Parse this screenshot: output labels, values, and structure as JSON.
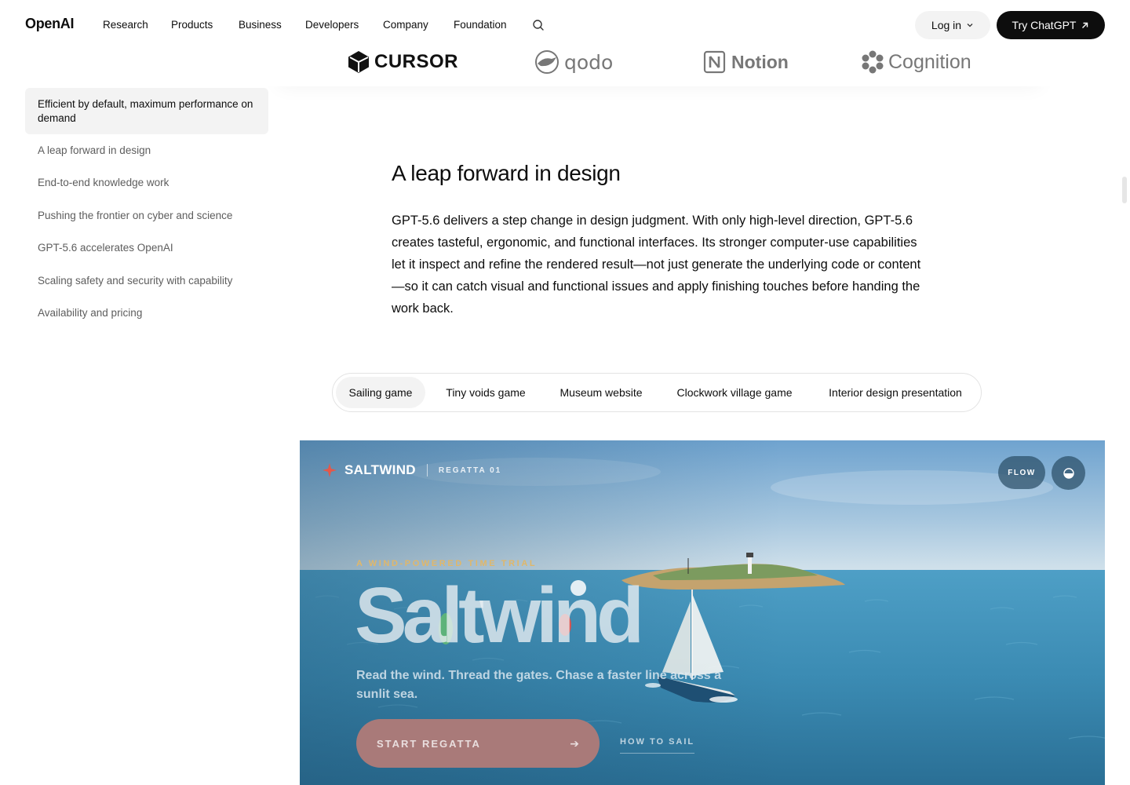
{
  "nav": {
    "logo": "OpenAI",
    "links": [
      "Research",
      "Products",
      "Business",
      "Developers",
      "Company",
      "Foundation"
    ],
    "login_label": "Log in",
    "try_label": "Try ChatGPT"
  },
  "partners": {
    "cursor": "CURSOR",
    "qodo": "qodo",
    "notion": "Notion",
    "cognition": "Cognition"
  },
  "toc": {
    "active": "Efficient by default, maximum performance on demand",
    "items": [
      "A leap forward in design",
      "End-to-end knowledge work",
      "Pushing the frontier on cyber and science",
      "GPT-5.6 accelerates OpenAI",
      "Scaling safety and security with capability",
      "Availability and pricing"
    ]
  },
  "article": {
    "heading": "A leap forward in design",
    "body": "GPT-5.6 delivers a step change in design judgment. With only high-level direction, GPT-5.6 creates tasteful, ergonomic, and functional interfaces. Its stronger computer-use capabilities let it inspect and refine the rendered result—not just generate the underlying code or content—so it can catch visual and functional issues and apply finishing touches before handing the work back."
  },
  "tabs": [
    "Sailing game",
    "Tiny voids game",
    "Museum website",
    "Clockwork village game",
    "Interior design presentation"
  ],
  "game": {
    "brand": "SALTWIND",
    "subbrand": "REGATTA 01",
    "flow_label": "FLOW",
    "kicker": "A WIND-POWERED TIME TRIAL",
    "title": "Saltwind",
    "tagline": "Read the wind. Thread the gates. Chase a faster line across a sunlit sea.",
    "start_label": "START REGATTA",
    "how_label": "HOW TO SAIL"
  },
  "colors": {
    "accent_coral": "#e4584a",
    "sea": "#3d8fb5",
    "sky": "#7fb1d8",
    "cta_fill": "#a87a78"
  }
}
